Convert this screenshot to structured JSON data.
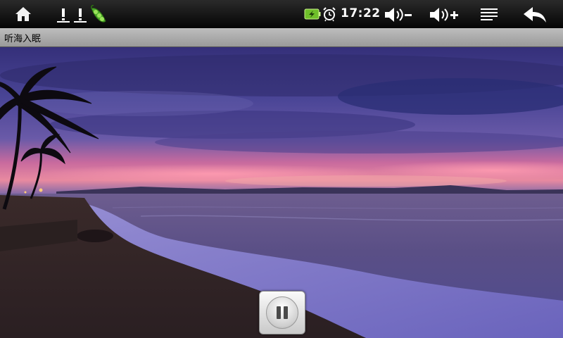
{
  "status_bar": {
    "time": "17:22",
    "icons": {
      "home": "home-icon",
      "warning_1": "warning-icon",
      "warning_2": "warning-icon",
      "app_notification": "pea-pod-icon",
      "battery": "battery-charging-icon",
      "alarm": "alarm-clock-icon",
      "volume_down": "volume-down-icon",
      "volume_up": "volume-up-icon",
      "menu": "menu-icon",
      "back": "back-arrow-icon"
    }
  },
  "title_bar": {
    "title": "听海入眠"
  },
  "player": {
    "control_icon": "pause-icon",
    "state": "playing"
  },
  "colors": {
    "status_bar_bg": "#0d0d0d",
    "title_bar_bg": "#aaaaaa",
    "battery_green": "#6fbf2a"
  }
}
